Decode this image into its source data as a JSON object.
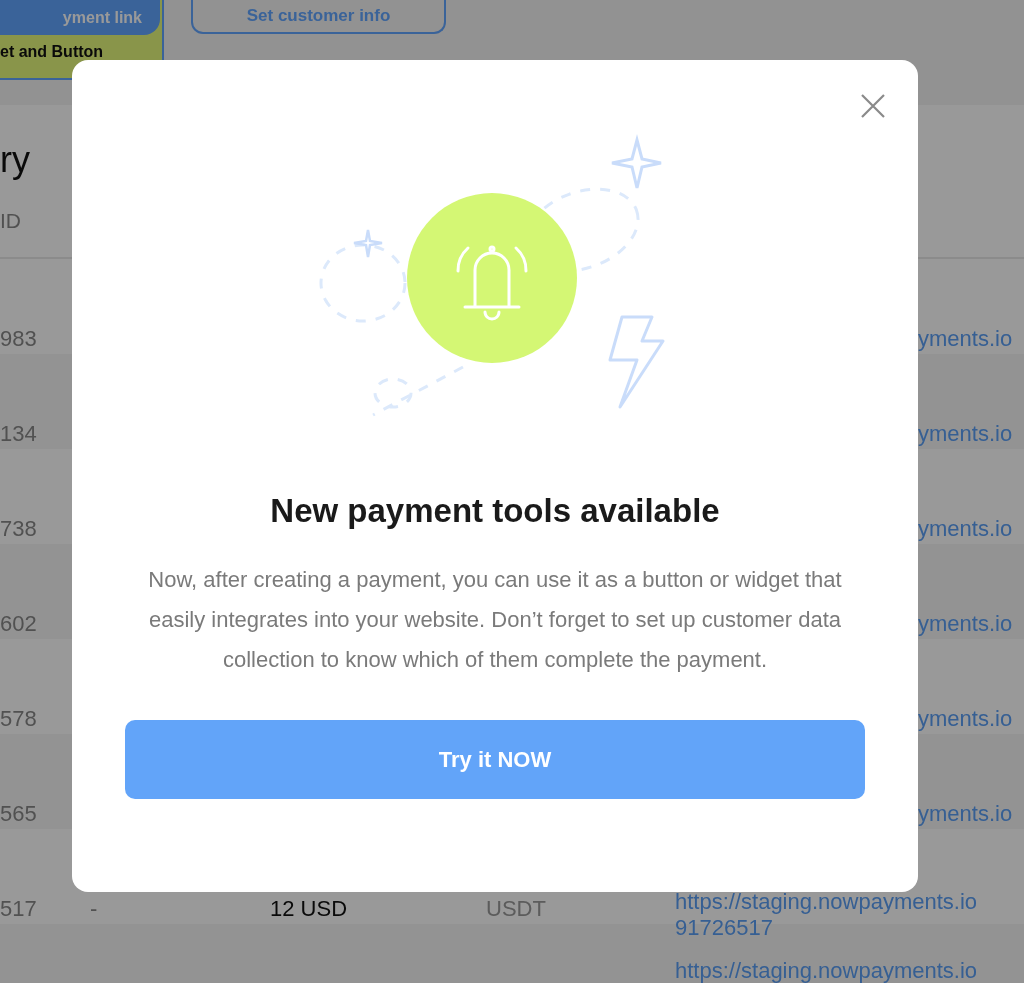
{
  "page": {
    "top_bar": {
      "payment_link_button": "yment link",
      "widget_tab": "et and Button",
      "customer_info_button": "Set customer info"
    },
    "heading": "ry",
    "table": {
      "columns": [
        "ID"
      ],
      "rows": [
        {
          "id": "983",
          "link": [
            "yments.io"
          ]
        },
        {
          "id": "134",
          "link": [
            "yments.io"
          ]
        },
        {
          "id": "738",
          "link": [
            "yments.io"
          ]
        },
        {
          "id": "602",
          "link": [
            "yments.io"
          ]
        },
        {
          "id": "578",
          "link": [
            "yments.io"
          ]
        },
        {
          "id": "565",
          "link": [
            "yments.io"
          ]
        },
        {
          "id": "517",
          "column_2": "-",
          "amount": "12 USD",
          "currency": "USDT",
          "link": [
            "https://staging.nowpayments.io",
            "91726517"
          ]
        },
        {
          "link": [
            "https://staging.nowpayments.io"
          ]
        }
      ]
    }
  },
  "modal": {
    "title": "New payment tools available",
    "body": "Now, after creating a payment, you can use it as a button or widget that easily integrates into your website. Don’t forget to set up customer data collection to know which of them complete the payment.",
    "button": "Try it NOW"
  }
}
